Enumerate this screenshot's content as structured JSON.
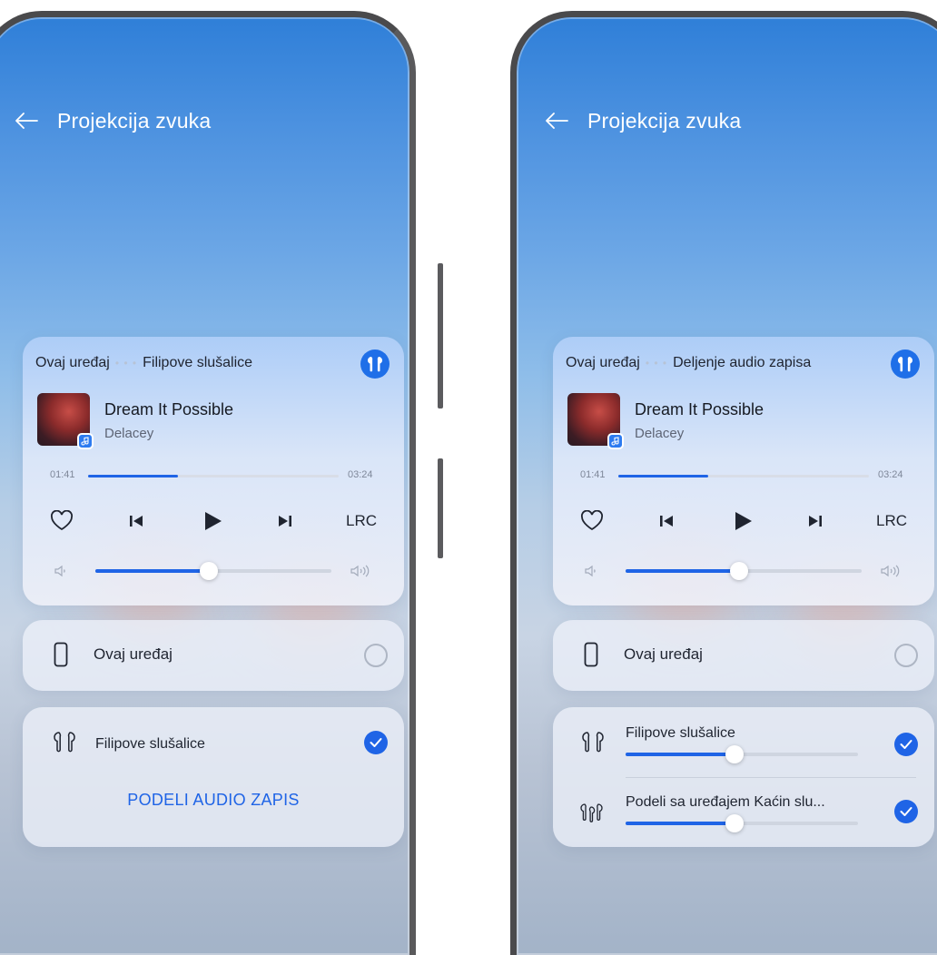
{
  "screen_left": {
    "header": {
      "title": "Projekcija zvuka"
    },
    "media": {
      "route_from": "Ovaj uređaj",
      "route_to": "Filipove slušalice",
      "song": "Dream It Possible",
      "artist": "Delacey",
      "time_elapsed": "01:41",
      "time_total": "03:24",
      "progress": 0.36,
      "volume": 0.48,
      "lrc_label": "LRC"
    },
    "device": {
      "label": "Ovaj uređaj"
    },
    "earphones": {
      "label": "Filipove slušalice",
      "share_label": "PODELI AUDIO ZAPIS"
    }
  },
  "screen_right": {
    "header": {
      "title": "Projekcija zvuka"
    },
    "media": {
      "route_from": "Ovaj uređaj",
      "route_to": "Deljenje audio zapisa",
      "song": "Dream It Possible",
      "artist": "Delacey",
      "time_elapsed": "01:41",
      "time_total": "03:24",
      "progress": 0.36,
      "volume": 0.48,
      "lrc_label": "LRC"
    },
    "device": {
      "label": "Ovaj uređaj"
    },
    "outputs": [
      {
        "label": "Filipove slušalice",
        "volume": 0.47
      },
      {
        "label": "Podeli sa uređajem Kaćin slu...",
        "volume": 0.47
      }
    ]
  },
  "colors": {
    "accent": "#1f64e6",
    "sky_top": "#2f7fd8",
    "card": "#ecf0f8"
  }
}
